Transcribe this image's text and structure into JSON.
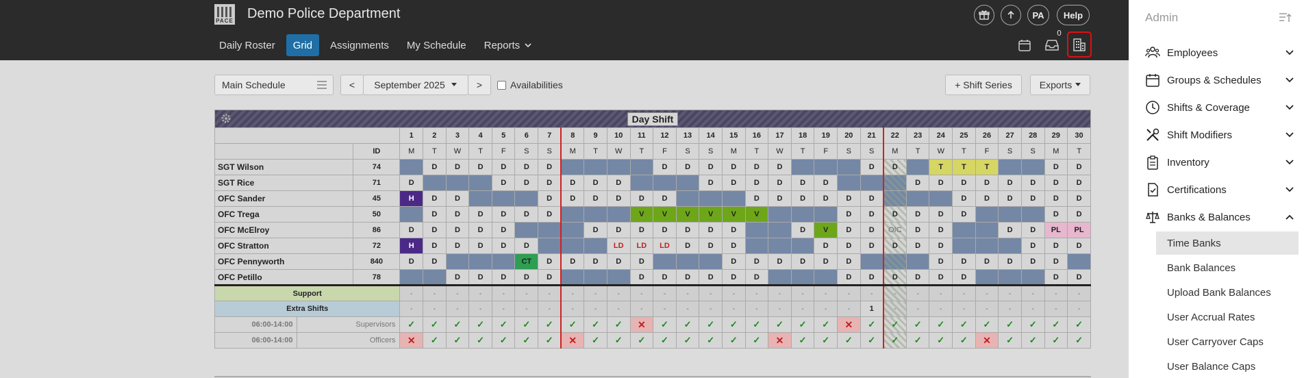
{
  "app": {
    "title": "Demo Police Department",
    "logo_text": "PACE"
  },
  "top_buttons": {
    "pa": "PA",
    "help": "Help"
  },
  "nav": [
    {
      "label": "Daily Roster",
      "active": false
    },
    {
      "label": "Grid",
      "active": true
    },
    {
      "label": "Assignments",
      "active": false
    },
    {
      "label": "My Schedule",
      "active": false
    },
    {
      "label": "Reports",
      "active": false
    }
  ],
  "inbox_badge": "0",
  "toolbar": {
    "schedule_select": "Main Schedule",
    "prev": "<",
    "month": "September 2025",
    "next": ">",
    "availabilities_label": "Availabilities",
    "shift_series_button": "+ Shift Series",
    "exports_button": "Exports"
  },
  "grid": {
    "shift_title": "Day Shift",
    "id_header": "ID",
    "days": [
      "1",
      "2",
      "3",
      "4",
      "5",
      "6",
      "7",
      "8",
      "9",
      "10",
      "11",
      "12",
      "13",
      "14",
      "15",
      "16",
      "17",
      "18",
      "19",
      "20",
      "21",
      "22",
      "23",
      "24",
      "25",
      "26",
      "27",
      "28",
      "29",
      "30"
    ],
    "weekdays": [
      "M",
      "T",
      "W",
      "T",
      "F",
      "S",
      "S",
      "M",
      "T",
      "W",
      "T",
      "F",
      "S",
      "S",
      "M",
      "T",
      "W",
      "T",
      "F",
      "S",
      "S",
      "M",
      "T",
      "W",
      "T",
      "F",
      "S",
      "S",
      "M",
      "T"
    ],
    "employees": [
      {
        "name": "SGT Wilson",
        "id": "74",
        "cells": [
          "o",
          "D",
          "D",
          "D",
          "D",
          "D",
          "D",
          "o",
          "o",
          "o",
          "o",
          "D",
          "D",
          "D",
          "D",
          "D",
          "D",
          "o",
          "o",
          "o",
          "D",
          "D",
          "o",
          "T",
          "T",
          "T",
          "o",
          "o",
          "D",
          "D"
        ]
      },
      {
        "name": "SGT Rice",
        "id": "71",
        "cells": [
          "D",
          "o",
          "o",
          "o",
          "D",
          "D",
          "D",
          "D",
          "D",
          "D",
          "o",
          "o",
          "o",
          "D",
          "D",
          "D",
          "D",
          "D",
          "D",
          "o",
          "o",
          "o",
          "D",
          "D",
          "D",
          "D",
          "D",
          "D",
          "D",
          "D"
        ]
      },
      {
        "name": "OFC Sander",
        "id": "45",
        "cells": [
          "H",
          "D",
          "D",
          "o",
          "o",
          "o",
          "D",
          "D",
          "D",
          "D",
          "D",
          "D",
          "o",
          "o",
          "o",
          "D",
          "D",
          "D",
          "D",
          "D",
          "D",
          "o",
          "o",
          "o",
          "D",
          "D",
          "D",
          "D",
          "D",
          "D"
        ]
      },
      {
        "name": "OFC Trega",
        "id": "50",
        "cells": [
          "o",
          "D",
          "D",
          "D",
          "D",
          "D",
          "D",
          "o",
          "o",
          "o",
          "V",
          "V",
          "V",
          "V",
          "V",
          "V",
          "o",
          "o",
          "o",
          "D",
          "D",
          "D",
          "D",
          "D",
          "D",
          "o",
          "o",
          "o",
          "D",
          "D"
        ]
      },
      {
        "name": "OFC McElroy",
        "id": "86",
        "cells": [
          "D",
          "D",
          "D",
          "D",
          "D",
          "o",
          "o",
          "o",
          "D",
          "D",
          "D",
          "D",
          "D",
          "D",
          "D",
          "o",
          "o",
          "D",
          "V",
          "D",
          "D",
          "OIC",
          "D",
          "D",
          "o",
          "o",
          "D",
          "D",
          "PL",
          "PL"
        ]
      },
      {
        "name": "OFC Stratton",
        "id": "72",
        "cells": [
          "H",
          "D",
          "D",
          "D",
          "D",
          "D",
          "o",
          "o",
          "o",
          "LD",
          "LD",
          "LD",
          "D",
          "D",
          "D",
          "o",
          "o",
          "o",
          "D",
          "D",
          "D",
          "D",
          "D",
          "D",
          "o",
          "o",
          "o",
          "D",
          "D",
          "D"
        ]
      },
      {
        "name": "OFC Pennyworth",
        "id": "840",
        "cells": [
          "D",
          "D",
          "o",
          "o",
          "o",
          "CT",
          "D",
          "D",
          "D",
          "D",
          "D",
          "o",
          "o",
          "o",
          "D",
          "D",
          "D",
          "D",
          "D",
          "D",
          "o",
          "o",
          "o",
          "D",
          "D",
          "D",
          "D",
          "D",
          "D",
          "o"
        ]
      },
      {
        "name": "OFC Petillo",
        "id": "78",
        "cells": [
          "o",
          "o",
          "D",
          "D",
          "D",
          "D",
          "D",
          "o",
          "o",
          "o",
          "D",
          "D",
          "D",
          "D",
          "D",
          "D",
          "o",
          "o",
          "o",
          "D",
          "D",
          "D",
          "D",
          "D",
          "D",
          "o",
          "o",
          "o",
          "D",
          "D"
        ]
      }
    ],
    "support": {
      "label": "Support",
      "cells": [
        "-",
        "-",
        "-",
        "-",
        "-",
        "-",
        "-",
        "-",
        "-",
        "-",
        "-",
        "-",
        "-",
        "-",
        "-",
        "-",
        "-",
        "-",
        "-",
        "-",
        "-",
        "-",
        "-",
        "-",
        "-",
        "-",
        "-",
        "-",
        "-",
        "-"
      ]
    },
    "extra": {
      "label": "Extra Shifts",
      "cells": [
        "-",
        "-",
        "-",
        "-",
        "-",
        "-",
        "-",
        "-",
        "-",
        "-",
        "-",
        "-",
        "-",
        "-",
        "-",
        "-",
        "-",
        "-",
        "-",
        "-",
        "1",
        "-",
        "-",
        "-",
        "-",
        "-",
        "-",
        "-",
        "-",
        "-"
      ]
    },
    "coverage": [
      {
        "time": "06:00-14:00",
        "label": "Supervisors",
        "cells": [
          "ok",
          "ok",
          "ok",
          "ok",
          "ok",
          "ok",
          "ok",
          "ok",
          "ok",
          "ok",
          "x",
          "ok",
          "ok",
          "ok",
          "ok",
          "ok",
          "ok",
          "ok",
          "ok",
          "x",
          "ok",
          "ok",
          "ok",
          "ok",
          "ok",
          "ok",
          "ok",
          "ok",
          "ok",
          "ok"
        ]
      },
      {
        "time": "06:00-14:00",
        "label": "Officers",
        "cells": [
          "x",
          "ok",
          "ok",
          "ok",
          "ok",
          "ok",
          "ok",
          "x",
          "ok",
          "ok",
          "ok",
          "ok",
          "ok",
          "ok",
          "ok",
          "ok",
          "x",
          "ok",
          "ok",
          "ok",
          "ok",
          "ok",
          "ok",
          "ok",
          "ok",
          "x",
          "ok",
          "ok",
          "ok",
          "ok"
        ]
      }
    ],
    "check_glyph": "✓",
    "cross_glyph": "✕"
  },
  "sidebar": {
    "title": "Admin",
    "items": [
      {
        "label": "Employees",
        "icon": "people-icon"
      },
      {
        "label": "Groups & Schedules",
        "icon": "calendar-icon"
      },
      {
        "label": "Shifts & Coverage",
        "icon": "clock-icon"
      },
      {
        "label": "Shift Modifiers",
        "icon": "tools-icon"
      },
      {
        "label": "Inventory",
        "icon": "clipboard-icon"
      },
      {
        "label": "Certifications",
        "icon": "certificate-icon"
      },
      {
        "label": "Banks & Balances",
        "icon": "scale-icon"
      }
    ],
    "sub_items": [
      {
        "label": "Time Banks",
        "active": true
      },
      {
        "label": "Bank Balances",
        "active": false
      },
      {
        "label": "Upload Bank Balances",
        "active": false
      },
      {
        "label": "User Accrual Rates",
        "active": false
      },
      {
        "label": "User Carryover Caps",
        "active": false
      },
      {
        "label": "User Balance Caps",
        "active": false
      }
    ]
  },
  "colors": {
    "topbar": "#2b2b2b",
    "nav_active": "#1f6fa6",
    "off_cell": "#7487a5",
    "holiday": "#4b2a87",
    "vacation": "#6ea61a",
    "training": "#d6d664",
    "personal_leave": "#e7b7cf",
    "comp_time": "#2e9e52",
    "highlight_border": "#e01010"
  }
}
